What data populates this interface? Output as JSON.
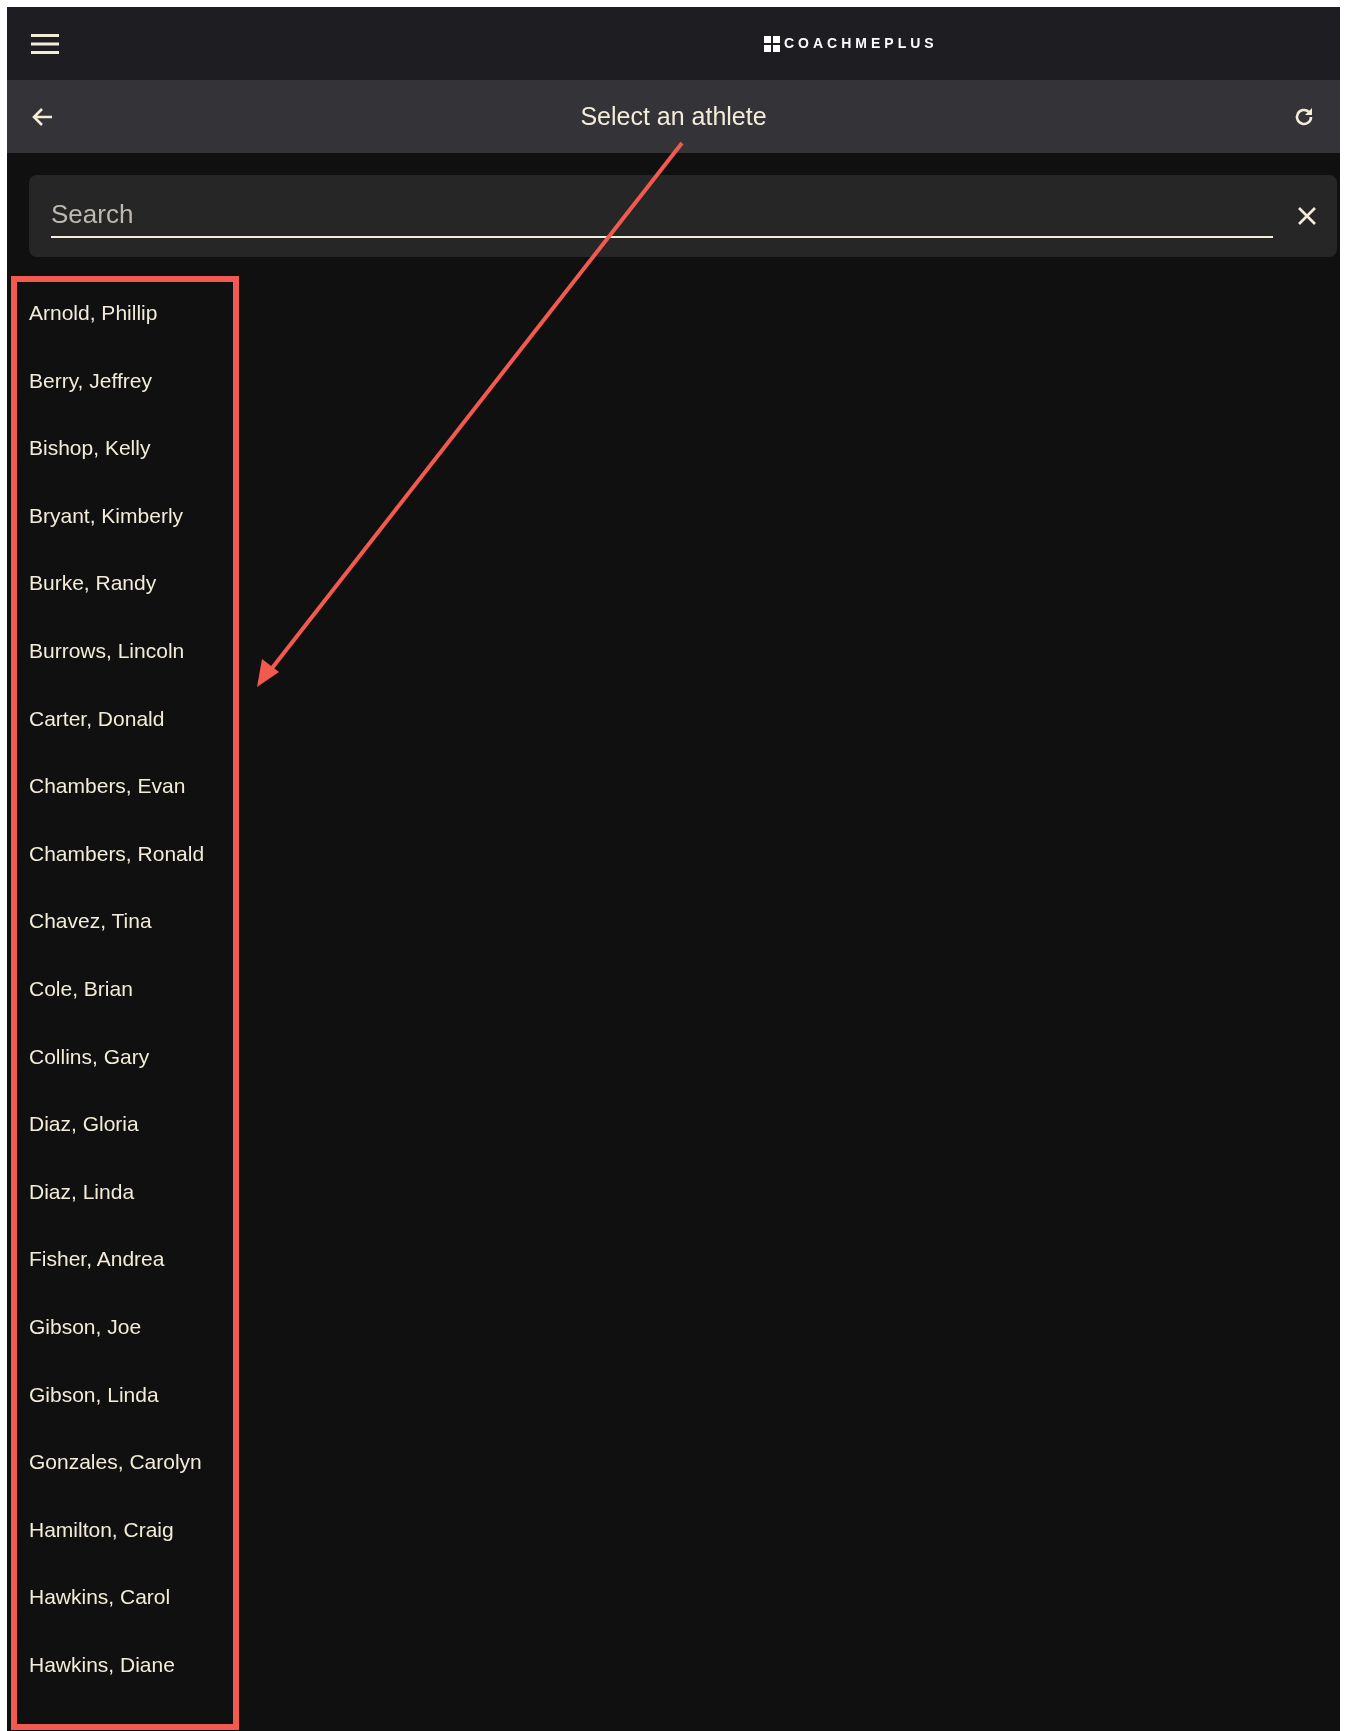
{
  "header": {
    "logo_text": "COACHMEPLUS"
  },
  "toolbar": {
    "title": "Select an athlete"
  },
  "search": {
    "placeholder": "Search"
  },
  "athletes": [
    "Arnold, Phillip",
    "Berry, Jeffrey",
    "Bishop, Kelly",
    "Bryant, Kimberly",
    "Burke, Randy",
    "Burrows, Lincoln",
    "Carter, Donald",
    "Chambers, Evan",
    "Chambers, Ronald",
    "Chavez, Tina",
    "Cole, Brian",
    "Collins, Gary",
    "Diaz, Gloria",
    "Diaz, Linda",
    "Fisher, Andrea",
    "Gibson, Joe",
    "Gibson, Linda",
    "Gonzales, Carolyn",
    "Hamilton, Craig",
    "Hawkins, Carol",
    "Hawkins, Diane"
  ]
}
